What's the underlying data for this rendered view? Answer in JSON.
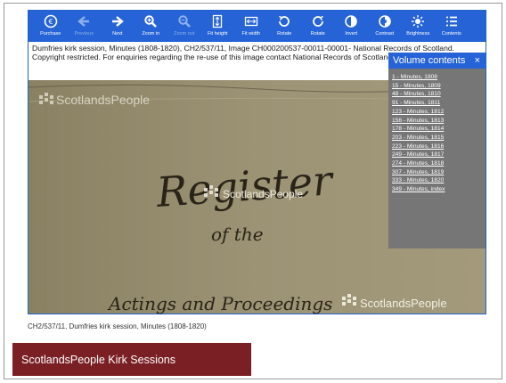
{
  "toolbar": {
    "items": [
      {
        "label": "Purchase",
        "icon": "purchase-icon"
      },
      {
        "label": "Previous",
        "icon": "arrow-left-icon"
      },
      {
        "label": "Next",
        "icon": "arrow-right-icon"
      },
      {
        "label": "Zoom in",
        "icon": "zoom-in-icon"
      },
      {
        "label": "Zoom out",
        "icon": "zoom-out-icon"
      },
      {
        "label": "Fit height",
        "icon": "fit-height-icon"
      },
      {
        "label": "Fit width",
        "icon": "fit-width-icon"
      },
      {
        "label": "Rotate",
        "icon": "rotate-left-icon"
      },
      {
        "label": "Rotate",
        "icon": "rotate-right-icon"
      },
      {
        "label": "Invert",
        "icon": "invert-icon"
      },
      {
        "label": "Contrast",
        "icon": "contrast-icon"
      },
      {
        "label": "Brightness",
        "icon": "brightness-icon"
      },
      {
        "label": "Contents",
        "icon": "contents-icon"
      }
    ]
  },
  "caption": {
    "text": "Dumfries kirk session, Minutes (1808-1820), CH2/537/11, Image CH000200537-00011-00001- National Records of Scotland. Copyright restricted. For enquiries regarding the re-use of this image contact National Records of Scotland."
  },
  "image": {
    "watermark_top": "ScotlandsPeople",
    "watermark_mid": "ScotlandsPeople",
    "watermark_bottom": "ScotlandsPeople",
    "script_line1": "Register",
    "script_line2": "of the",
    "script_line3": "Actings and Proceedings"
  },
  "volume_contents": {
    "title": "Volume contents",
    "close": "×",
    "items": [
      "1 - Minutes, 1808",
      "15 - Minutes, 1809",
      "48 - Minutes, 1810",
      "91 - Minutes, 1811",
      "123 - Minutes, 1812",
      "156 - Minutes, 1813",
      "178 - Minutes, 1814",
      "203 - Minutes, 1815",
      "223 - Minutes, 1816",
      "249 - Minutes, 1817",
      "274 - Minutes, 1818",
      "307 - Minutes, 1819",
      "333 - Minutes, 1820",
      "349 - Minutes, index"
    ]
  },
  "below_caption": "CH2/537/11, Dumfries kirk session, Minutes (1808-1820)",
  "banner": "ScotlandsPeople Kirk Sessions",
  "colors": {
    "toolbar": "#2563d6",
    "panel": "#767676",
    "banner": "#7a1f24"
  }
}
